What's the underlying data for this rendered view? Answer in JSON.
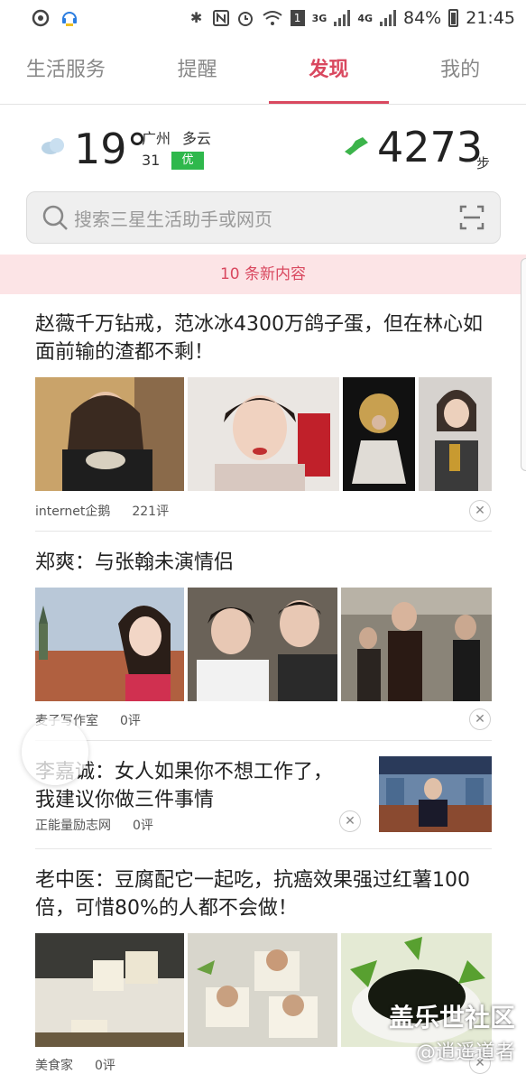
{
  "status_bar": {
    "time": "21:45",
    "battery": "84%",
    "network_1": "3G",
    "network_2": "4G",
    "sim_badge": "1",
    "left_icons": [
      "notification-app-icon",
      "support-icon"
    ],
    "right_icons": [
      "bluetooth-icon",
      "nfc-icon",
      "alarm-icon",
      "wifi-icon",
      "signal-icon",
      "battery-icon"
    ]
  },
  "tabs": [
    {
      "label": "生活服务",
      "active": false
    },
    {
      "label": "提醒",
      "active": false
    },
    {
      "label": "发现",
      "active": true
    },
    {
      "label": "我的",
      "active": false
    }
  ],
  "weather": {
    "temperature": "19°",
    "city": "广州",
    "condition": "多云",
    "aqi_value": "31",
    "aqi_label": "优",
    "steps": "4273",
    "steps_unit": "步"
  },
  "search": {
    "placeholder": "搜索三星生活助手或网页"
  },
  "banner": {
    "text": "10 条新内容"
  },
  "articles": [
    {
      "title": "赵薇千万钻戒，范冰冰4300万鸽子蛋，但在林心如面前输的渣都不剩！",
      "source": "internet企鹅",
      "comments": "221评"
    },
    {
      "title": "郑爽：与张翰未演情侣",
      "source": "麦子写作室",
      "comments": "0评"
    },
    {
      "title": "李嘉诚：女人如果你不想工作了，我建议你做三件事情",
      "source": "正能量励志网",
      "comments": "0评"
    },
    {
      "title": "老中医：豆腐配它一起吃，抗癌效果强过红薯100倍，可惜80%的人都不会做！",
      "source": "美食家",
      "comments": "0评"
    }
  ],
  "watermark": {
    "line1": "盖乐世社区",
    "line2": "@逍遥道者"
  },
  "colors": {
    "accent": "#d9485f",
    "banner_bg": "#fce4e6",
    "aqi_good": "#2fb84c",
    "step_icon": "#3cb44b"
  }
}
